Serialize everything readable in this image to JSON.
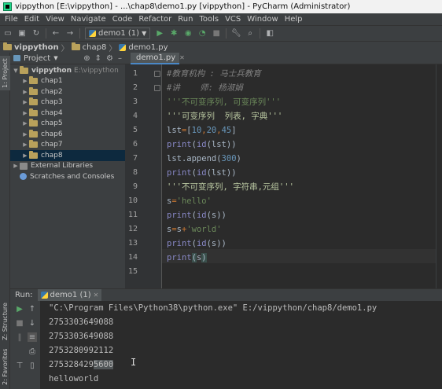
{
  "title_bar": {
    "text": "vippython [E:\\vippython] - ...\\chap8\\demo1.py [vippython] - PyCharm (Administrator)"
  },
  "menu": [
    "File",
    "Edit",
    "View",
    "Navigate",
    "Code",
    "Refactor",
    "Run",
    "Tools",
    "VCS",
    "Window",
    "Help"
  ],
  "toolbar": {
    "run_config": "demo1 (1)"
  },
  "navbar": {
    "crumbs": [
      "vippython",
      "chap8",
      "demo1.py"
    ]
  },
  "side_tabs": {
    "project": "1: Project",
    "structure": "Z: Structure",
    "favorites": "2: Favorites"
  },
  "project_panel": {
    "header": "Project",
    "root": "vippython",
    "root_path": "E:\\vippython",
    "folders": [
      "chap1",
      "chap2",
      "chap3",
      "chap4",
      "chap5",
      "chap6",
      "chap7",
      "chap8"
    ],
    "selected": "chap8",
    "external_libraries": "External Libraries",
    "scratches": "Scratches and Consoles"
  },
  "editor": {
    "tab": "demo1.py",
    "current_line": 14,
    "lines": [
      {
        "n": "1",
        "segs": [
          {
            "t": "#教育机构 : 马士兵教育",
            "c": "c-comment"
          }
        ]
      },
      {
        "n": "2",
        "segs": [
          {
            "t": "#讲    师: 杨淑娟",
            "c": "c-comment"
          }
        ]
      },
      {
        "n": "3",
        "segs": [
          {
            "t": "'''不可变序列, 可变序列'''",
            "c": "c-string"
          }
        ]
      },
      {
        "n": "4",
        "segs": [
          {
            "t": "'''可变序列  列表, 字典'''",
            "c": "c-string-ident"
          }
        ]
      },
      {
        "n": "5",
        "segs": [
          {
            "t": "lst",
            "c": "c-text"
          },
          {
            "t": "=",
            "c": "c-op"
          },
          {
            "t": "[",
            "c": "c-text"
          },
          {
            "t": "10",
            "c": "c-num"
          },
          {
            "t": ",",
            "c": "c-op"
          },
          {
            "t": "20",
            "c": "c-num"
          },
          {
            "t": ",",
            "c": "c-op"
          },
          {
            "t": "45",
            "c": "c-num"
          },
          {
            "t": "]",
            "c": "c-text"
          }
        ]
      },
      {
        "n": "6",
        "segs": [
          {
            "t": "print",
            "c": "c-fn"
          },
          {
            "t": "(",
            "c": "c-text"
          },
          {
            "t": "id",
            "c": "c-fn"
          },
          {
            "t": "(lst))",
            "c": "c-text"
          }
        ]
      },
      {
        "n": "7",
        "segs": [
          {
            "t": "lst.append(",
            "c": "c-text"
          },
          {
            "t": "300",
            "c": "c-num"
          },
          {
            "t": ")",
            "c": "c-text"
          }
        ]
      },
      {
        "n": "8",
        "segs": [
          {
            "t": "print",
            "c": "c-fn"
          },
          {
            "t": "(",
            "c": "c-text"
          },
          {
            "t": "id",
            "c": "c-fn"
          },
          {
            "t": "(lst))",
            "c": "c-text"
          }
        ]
      },
      {
        "n": "9",
        "segs": [
          {
            "t": "'''不可变序列, 字符串,元组'''",
            "c": "c-string-ident"
          }
        ]
      },
      {
        "n": "10",
        "segs": [
          {
            "t": "s",
            "c": "c-text"
          },
          {
            "t": "=",
            "c": "c-op"
          },
          {
            "t": "'hello'",
            "c": "c-string"
          }
        ]
      },
      {
        "n": "11",
        "segs": [
          {
            "t": "print",
            "c": "c-fn"
          },
          {
            "t": "(",
            "c": "c-text"
          },
          {
            "t": "id",
            "c": "c-fn"
          },
          {
            "t": "(s))",
            "c": "c-text"
          }
        ]
      },
      {
        "n": "12",
        "segs": [
          {
            "t": "s",
            "c": "c-text"
          },
          {
            "t": "=",
            "c": "c-op"
          },
          {
            "t": "s",
            "c": "c-text"
          },
          {
            "t": "+",
            "c": "c-op"
          },
          {
            "t": "'world'",
            "c": "c-string"
          }
        ]
      },
      {
        "n": "13",
        "segs": [
          {
            "t": "print",
            "c": "c-fn"
          },
          {
            "t": "(",
            "c": "c-text"
          },
          {
            "t": "id",
            "c": "c-fn"
          },
          {
            "t": "(s))",
            "c": "c-text"
          }
        ]
      },
      {
        "n": "14",
        "segs": [
          {
            "t": "print",
            "c": "c-fn"
          },
          {
            "t": "(",
            "c": "c-text cur-hl"
          },
          {
            "t": "s",
            "c": "c-text"
          },
          {
            "t": ")",
            "c": "c-text cur-hl"
          }
        ]
      },
      {
        "n": "15",
        "segs": []
      }
    ]
  },
  "run_panel": {
    "label": "Run:",
    "tab": "demo1 (1)",
    "output": [
      "\"C:\\Program Files\\Python38\\python.exe\" E:/vippython/chap8/demo1.py",
      "2753303649088",
      "2753303649088",
      "2753280992112",
      "2753284295600",
      "helloworld"
    ]
  }
}
